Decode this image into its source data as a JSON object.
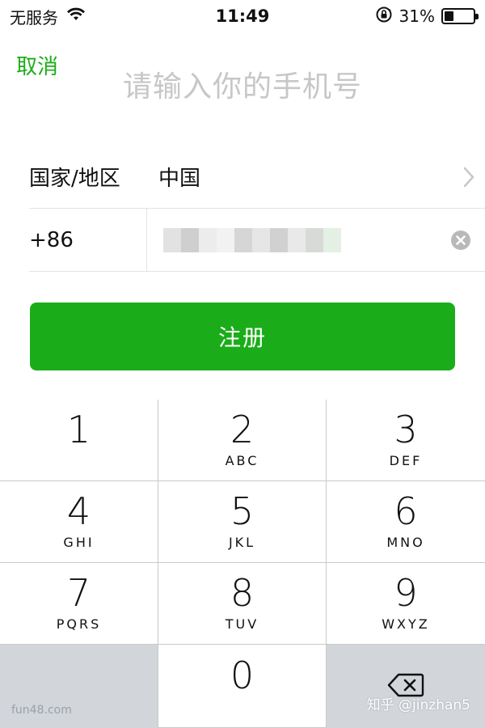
{
  "status_bar": {
    "carrier": "无服务",
    "time": "11:49",
    "battery_percent": "31%",
    "battery_level": 0.31,
    "icons": [
      "wifi-icon",
      "rotation-lock-icon",
      "battery-icon"
    ]
  },
  "header": {
    "cancel_label": "取消",
    "title": "请输入你的手机号"
  },
  "form": {
    "country_label": "国家/地区",
    "country_value": "中国",
    "phone_prefix": "+86",
    "phone_value_obscured": true
  },
  "register_label": "注册",
  "keypad": {
    "keys": [
      {
        "num": "1",
        "letters": ""
      },
      {
        "num": "2",
        "letters": "ABC"
      },
      {
        "num": "3",
        "letters": "DEF"
      },
      {
        "num": "4",
        "letters": "GHI"
      },
      {
        "num": "5",
        "letters": "JKL"
      },
      {
        "num": "6",
        "letters": "MNO"
      },
      {
        "num": "7",
        "letters": "PQRS"
      },
      {
        "num": "8",
        "letters": "TUV"
      },
      {
        "num": "9",
        "letters": "WXYZ"
      },
      {
        "num": "0",
        "letters": ""
      }
    ]
  },
  "watermarks": {
    "left": "fun48.com",
    "right": "知乎 @jinzhan5"
  },
  "colors": {
    "accent": "#1aad19",
    "placeholder": "#c7c7c7",
    "divider": "#e3e3e3",
    "keypad_gray": "#d2d6db"
  }
}
